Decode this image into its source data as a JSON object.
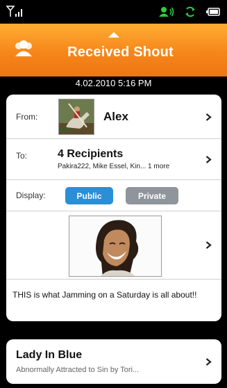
{
  "header": {
    "title": "Received Shout"
  },
  "shout": {
    "date": "4.02.2010 5:16 PM",
    "from_label": "From:",
    "from_name": "Alex",
    "to_label": "To:",
    "to_count": "4 Recipients",
    "to_names": "Pakira222, Mike Essel, Kin... 1 more",
    "display_label": "Display:",
    "public_label": "Public",
    "private_label": "Private",
    "message": "THIS is what Jamming on a Saturday is all about!!"
  },
  "song": {
    "title": "Lady In Blue",
    "subtitle": "Abnormally Attracted to Sin by Tori..."
  },
  "icons": {
    "signal": "signal-icon",
    "headset": "headset-icon",
    "sync": "sync-icon",
    "battery": "battery-icon",
    "people": "people-icon",
    "chevron": "chevron-right-icon"
  },
  "colors": {
    "header": "#f6861b",
    "public": "#2b8fd6",
    "private": "#8f959a",
    "status_green": "#2ecc40"
  }
}
